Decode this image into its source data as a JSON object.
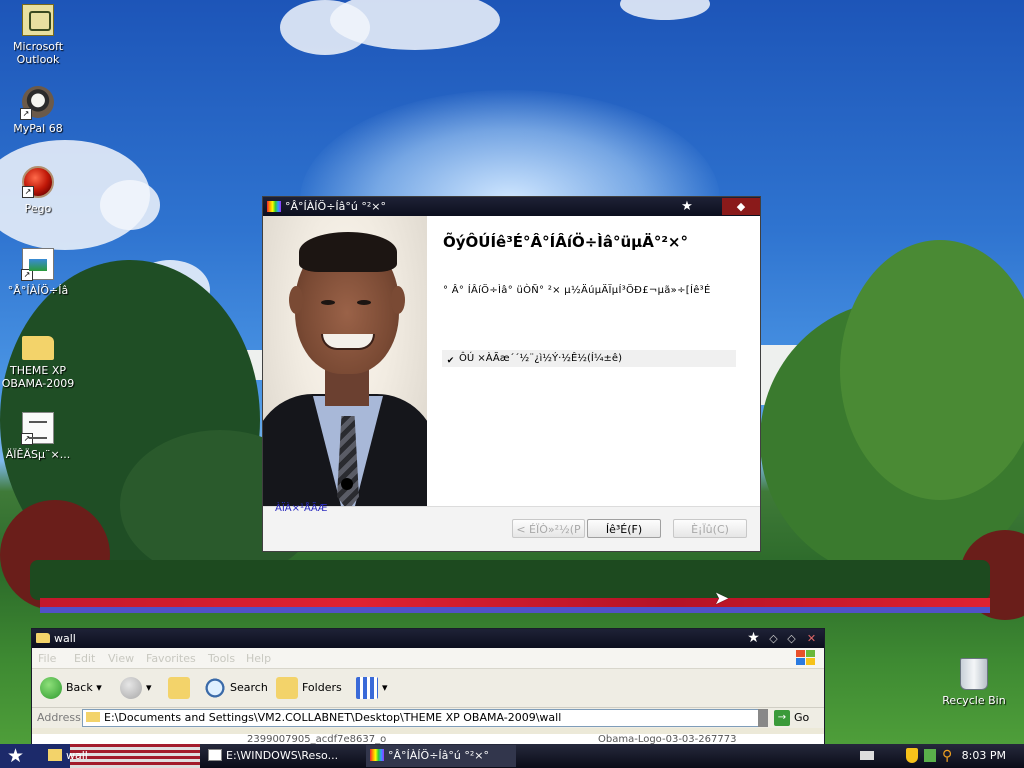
{
  "desktop": {
    "icons": [
      {
        "label": "Microsoft Outlook",
        "icon": "outlook-icon"
      },
      {
        "label": "MyPal 68",
        "icon": "raccoon-icon"
      },
      {
        "label": "Pego",
        "icon": "pego-icon"
      },
      {
        "label": "°Å°ÍÀÍÖ÷Íâ",
        "icon": "image-icon"
      },
      {
        "label": "THEME XP OBAMA-2009",
        "icon": "folder-icon"
      },
      {
        "label": "ÄÏÊÄSµ¨×...",
        "icon": "document-icon"
      }
    ],
    "recycle_bin": "Recycle Bin"
  },
  "dialog": {
    "title": "°Â°ÍÀÍÖ÷Íâ°ú °²×°",
    "heading": "ÕýÔÚÍê³É°Â°ÍÂíÖ÷Ìâ°üµÄ°²×°",
    "text": "° Â° ÍÂíÖ÷Ìâ° üÒÑ° ²× µ½ÄúµÄÏµÍ³ÖÐ£¬µã»÷[Íê³É",
    "checkbox_label": "ÔÚ ×ÀÃæ´´½¨¿ì½Ý·½Ê½(Í¼±ê)",
    "brand": "ÀÏÀ×¹ÅÃÆ",
    "back_button": "< ÉÏÒ»²½(P",
    "finish_button": "Íê³É(F)",
    "cancel_button": "È¡Ïû(C)",
    "colors": {
      "titlebar": "#0c0f1e",
      "brand": "#2a2abf"
    }
  },
  "explorer": {
    "title": "wall",
    "menu": [
      "File",
      "Edit",
      "View",
      "Favorites",
      "Tools",
      "Help"
    ],
    "toolbar": {
      "back": "Back",
      "search": "Search",
      "folders": "Folders"
    },
    "address_label": "Address",
    "address_value": "E:\\Documents and Settings\\VM2.COLLABNET\\Desktop\\THEME XP OBAMA-2009\\wall",
    "go": "Go",
    "files": [
      "2399007905_acdf7e8637_o",
      "Obama-Logo-03-03-267773"
    ]
  },
  "taskbar": {
    "tasks": [
      {
        "label": "wall",
        "icon": "folder-icon"
      },
      {
        "label": "E:\\WINDOWS\\Reso...",
        "icon": "notepad-icon"
      },
      {
        "label": "°Â°ÍÀÍÖ÷Íâ°ú °²×°",
        "icon": "installer-icon"
      }
    ],
    "clock": "8:03 PM"
  }
}
